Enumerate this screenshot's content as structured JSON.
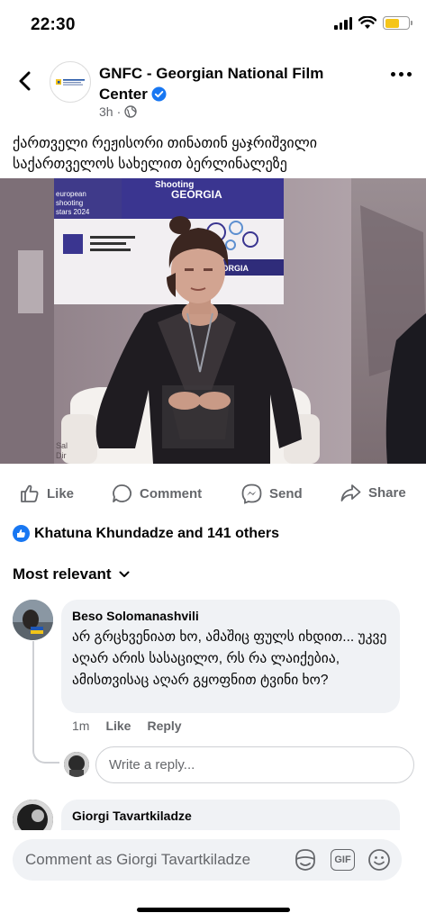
{
  "status_bar": {
    "time": "22:30"
  },
  "post": {
    "page_name": "GNFC - Georgian National Film Center",
    "time_ago": "3h",
    "text": "ქართველი რეჟისორი თინათინ ყაჯრიშვილი საქართველოს სახელით ბერლინალეზე"
  },
  "photo": {
    "banner_line1": "european",
    "banner_line2": "shooting",
    "banner_line3": "stars 2024",
    "banner_right_top": "Shooting",
    "banner_right": "GEORGIA",
    "sign_text": "IN GEORGIA"
  },
  "actions": {
    "like": "Like",
    "comment": "Comment",
    "send": "Send",
    "share": "Share"
  },
  "reactions": {
    "summary": "Khatuna Khundadze and 141 others"
  },
  "sort": {
    "label": "Most relevant"
  },
  "comments": [
    {
      "author": "Beso Solomanashvili",
      "text": "არ გრცხვენიათ ხო, ამაშიც ფულს იხდით... უკვე აღარ არის სასაცილო, რს რა ლაიქებია, ამისთვისაც აღარ გყოფნით ტვინი ხო?",
      "time": "1m",
      "like": "Like",
      "reply": "Reply"
    },
    {
      "author": "Giorgi Tavartkiladze",
      "text": ""
    }
  ],
  "reply_box": {
    "placeholder": "Write a reply..."
  },
  "composer": {
    "placeholder": "Comment as Giorgi Tavartkiladze",
    "gif_label": "GIF"
  },
  "colors": {
    "accent": "#1877f2",
    "secondary_text": "#65676b",
    "bubble": "#f0f2f5"
  }
}
